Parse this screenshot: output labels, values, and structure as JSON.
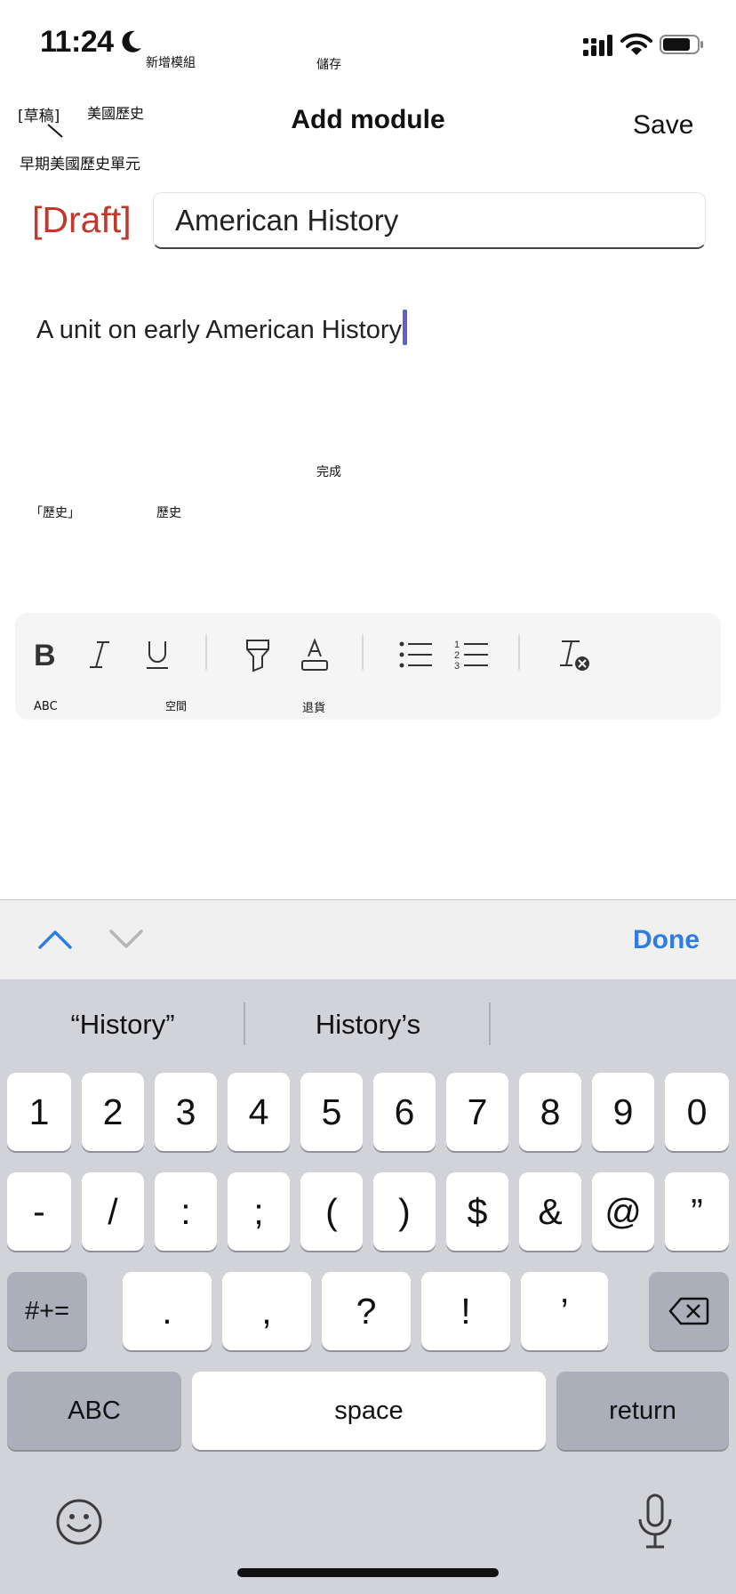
{
  "status_bar": {
    "time": "11:24"
  },
  "overlay_labels": {
    "add_module": "新增模組",
    "save": "儲存",
    "draft": "[草稿]",
    "american_history": "美國歷史",
    "unit_desc": "早期美國歷史單元",
    "done": "完成",
    "history_quoted": "「歷史」",
    "history": "歷史",
    "abc": "ABC",
    "space": "空間",
    "return": "退貨"
  },
  "nav": {
    "title": "Add module",
    "save_label": "Save"
  },
  "form": {
    "draft_label": "[Draft]",
    "title_value": "American History",
    "description": "A unit on early American History"
  },
  "accessory": {
    "done_label": "Done"
  },
  "keyboard": {
    "suggestions": [
      "“History”",
      "History’s",
      ""
    ],
    "row1": [
      "1",
      "2",
      "3",
      "4",
      "5",
      "6",
      "7",
      "8",
      "9",
      "0"
    ],
    "row2": [
      "-",
      "/",
      ":",
      ";",
      "(",
      ")",
      "$",
      "&",
      "@",
      "”"
    ],
    "row3_mid": [
      ".",
      ",",
      "?",
      "!",
      "’"
    ],
    "symbols_label": "#+=",
    "abc_label": "ABC",
    "space_label": "space",
    "return_label": "return"
  },
  "colors": {
    "accent": "#2f7ce3",
    "draft": "#c0392b",
    "caret": "#5b5fc7"
  }
}
